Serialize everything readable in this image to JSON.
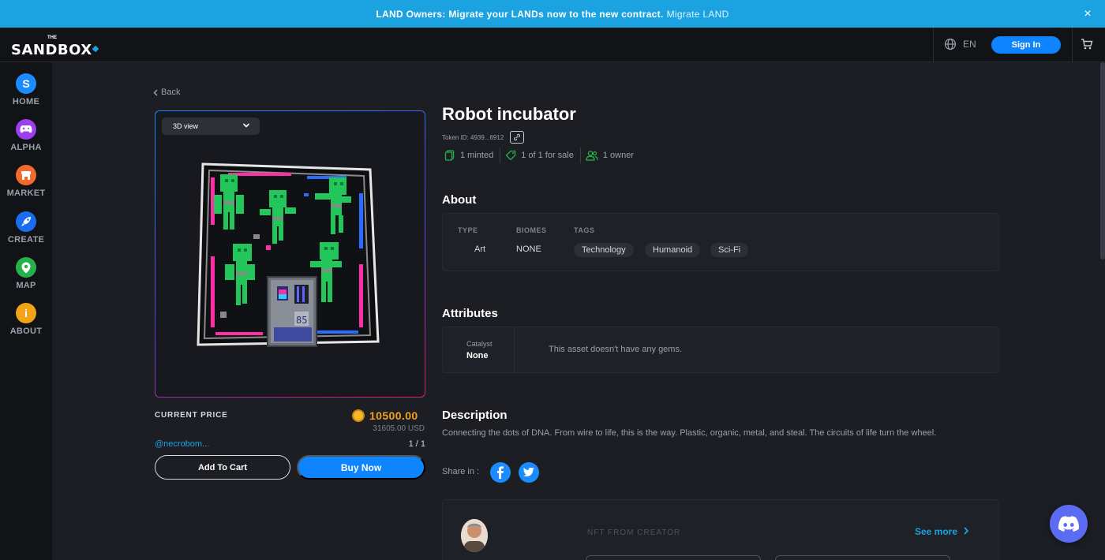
{
  "banner": {
    "message": "LAND Owners: Migrate your LANDs now to the new contract.",
    "link": "Migrate LAND",
    "close": "×"
  },
  "header": {
    "logo": "SANDBOX",
    "logo_the": "THE",
    "language": "EN",
    "signin_label": "Sign In"
  },
  "sidebar": {
    "items": [
      {
        "label": "HOME",
        "color": "#1a8cff",
        "glyph": "S"
      },
      {
        "label": "ALPHA",
        "color": "#9b3ff0",
        "glyph": "🎮"
      },
      {
        "label": "MARKET",
        "color": "#f26a2e",
        "glyph": "▣"
      },
      {
        "label": "CREATE",
        "color": "#1a6cf0",
        "glyph": "🚀"
      },
      {
        "label": "MAP",
        "color": "#27b14a",
        "glyph": "⌖"
      },
      {
        "label": "ABOUT",
        "color": "#f2a418",
        "glyph": "i"
      }
    ]
  },
  "back_label": "Back",
  "viewer": {
    "mode": "3D view"
  },
  "purchase": {
    "price_label": "CURRENT PRICE",
    "price": "10500.00",
    "price_usd": "31605.00 USD",
    "seller": "@necrobom...",
    "edition": "1 / 1",
    "add_to_cart": "Add To Cart",
    "buy_now": "Buy Now"
  },
  "asset": {
    "title": "Robot incubator",
    "token_id": "Token ID: 4939...6912",
    "minted": "1 minted",
    "for_sale": "1 of 1 for sale",
    "owners": "1 owner"
  },
  "about": {
    "heading": "About",
    "type_label": "TYPE",
    "type_value": "Art",
    "biomes_label": "BIOMES",
    "biomes_value": "NONE",
    "tags_label": "TAGS",
    "tags": [
      "Technology",
      "Humanoid",
      "Sci-Fi"
    ]
  },
  "attributes": {
    "heading": "Attributes",
    "catalyst_label": "Catalyst",
    "catalyst_value": "None",
    "gems_message": "This asset doesn't have any gems."
  },
  "description": {
    "heading": "Description",
    "text": "Connecting the dots of DNA. From wire to life, this is the way. Plastic, organic, metal, and steal. The circuits of life turn the wheel."
  },
  "share": {
    "label": "Share in :"
  },
  "creator": {
    "section_label": "NFT FROM CREATOR",
    "see_more": "See more"
  },
  "colors": {
    "accent": "#0f84ff",
    "banner": "#1aa3e0",
    "price": "#f0a21c",
    "discord": "#5c6cf2"
  }
}
